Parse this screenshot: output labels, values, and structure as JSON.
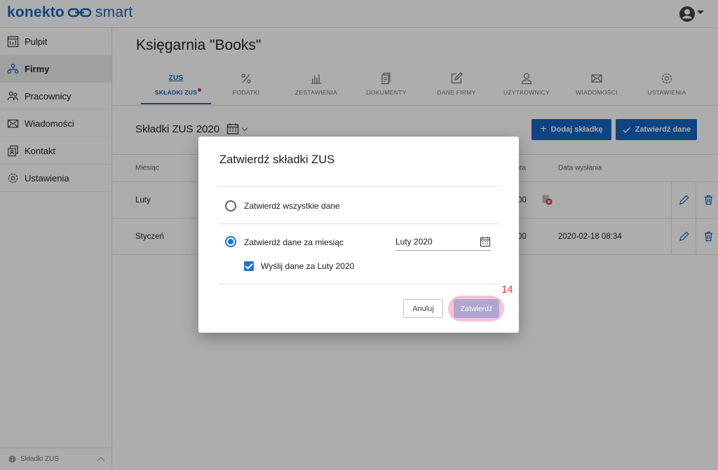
{
  "app": {
    "logo_part1": "konekto",
    "logo_part2": "smart"
  },
  "sidebar": {
    "items": [
      {
        "label": "Pulpit",
        "icon": "dashboard-icon"
      },
      {
        "label": "Firmy",
        "icon": "companies-icon",
        "active": true
      },
      {
        "label": "Pracownicy",
        "icon": "employees-icon"
      },
      {
        "label": "Wiadomości",
        "icon": "mail-icon"
      },
      {
        "label": "Kontakt",
        "icon": "contact-icon"
      },
      {
        "label": "Ustawienia",
        "icon": "gear-icon"
      }
    ],
    "footer_label": "Składki ZUS"
  },
  "main": {
    "title": "Księgarnia \"Books\"",
    "tabs": [
      {
        "label": "SKŁADKI ZUS",
        "icon_text": "ZUS",
        "active": true,
        "badge": true
      },
      {
        "label": "PODATKI",
        "icon": "percent-icon"
      },
      {
        "label": "ZESTAWIENIA",
        "icon": "bar-chart-icon"
      },
      {
        "label": "DOKUMENTY",
        "icon": "documents-icon"
      },
      {
        "label": "DANE FIRMY",
        "icon": "edit-icon"
      },
      {
        "label": "UŻYTKOWNICY",
        "icon": "user-icon"
      },
      {
        "label": "WIADOMOŚCI",
        "icon": "mail-icon"
      },
      {
        "label": "USTAWIENIA",
        "icon": "gear-icon"
      }
    ],
    "section_title": "Składki ZUS 2020",
    "add_button": "Dodaj składkę",
    "confirm_button": "Zatwierdź dane",
    "table": {
      "headers": {
        "month": "Miesiąc",
        "amount_fragment": "ota",
        "sent_date": "Data wysłania"
      },
      "rows": [
        {
          "month": "Luty",
          "amount_fragment": "00",
          "sent_date": ""
        },
        {
          "month": "Styczeń",
          "amount_fragment": "00",
          "sent_date": "2020-02-18 08:34"
        }
      ]
    }
  },
  "dialog": {
    "title": "Zatwierdź składki ZUS",
    "option_all": "Zatwierdź wszystkie dane",
    "option_month": "Zatwierdź dane za miesiąc",
    "month_value": "Luty 2020",
    "send_checkbox_label": "Wyślij dane za Luty 2020",
    "cancel_label": "Anuluj",
    "ok_label": "Zatwierdź",
    "step_number": "14"
  },
  "colors": {
    "accent": "#1565c0",
    "highlight": "#f48fb1",
    "step_number": "#e53935"
  }
}
